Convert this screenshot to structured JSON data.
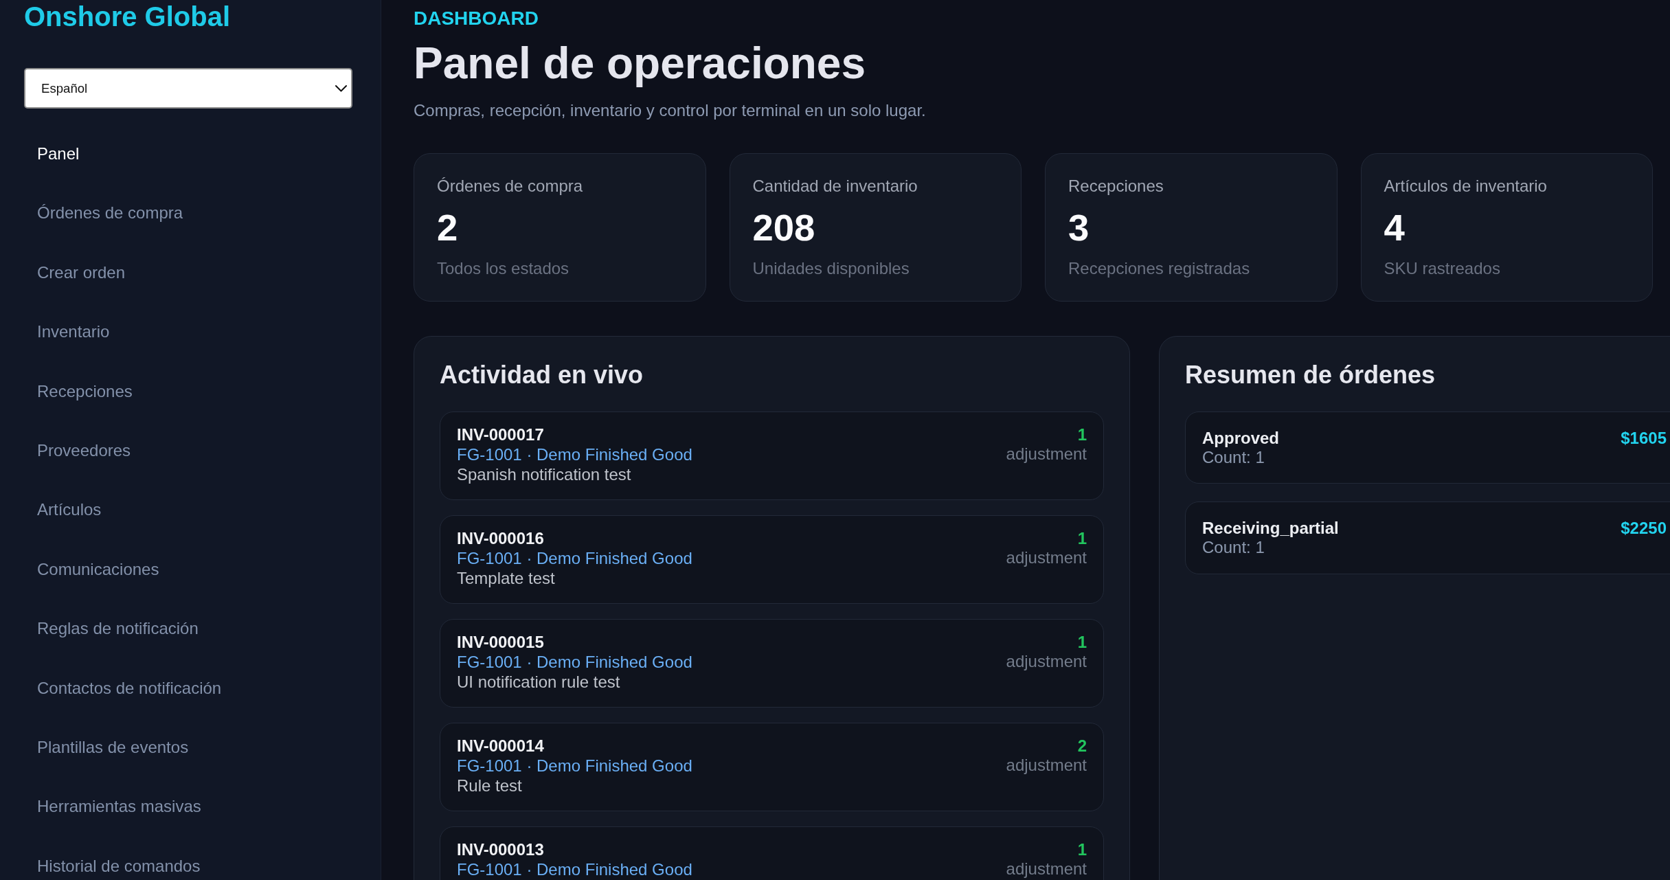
{
  "sidebar": {
    "brand": "Onshore Global",
    "language_select": {
      "value": "Español"
    },
    "items": [
      {
        "label": "Panel",
        "selected": true
      },
      {
        "label": "Órdenes de compra",
        "selected": false
      },
      {
        "label": "Crear orden",
        "selected": false
      },
      {
        "label": "Inventario",
        "selected": false
      },
      {
        "label": "Recepciones",
        "selected": false
      },
      {
        "label": "Proveedores",
        "selected": false
      },
      {
        "label": "Artículos",
        "selected": false
      },
      {
        "label": "Comunicaciones",
        "selected": false
      },
      {
        "label": "Reglas de notificación",
        "selected": false
      },
      {
        "label": "Contactos de notificación",
        "selected": false
      },
      {
        "label": "Plantillas de eventos",
        "selected": false
      },
      {
        "label": "Herramientas masivas",
        "selected": false
      },
      {
        "label": "Historial de comandos",
        "selected": false
      }
    ]
  },
  "header": {
    "eyebrow": "DASHBOARD",
    "title": "Panel de operaciones",
    "subtitle": "Compras, recepción, inventario y control por terminal en un solo lugar."
  },
  "stats": [
    {
      "label": "Órdenes de compra",
      "value": "2",
      "caption": "Todos los estados"
    },
    {
      "label": "Cantidad de inventario",
      "value": "208",
      "caption": "Unidades disponibles"
    },
    {
      "label": "Recepciones",
      "value": "3",
      "caption": "Recepciones registradas"
    },
    {
      "label": "Artículos de inventario",
      "value": "4",
      "caption": "SKU rastreados"
    }
  ],
  "activity": {
    "title": "Actividad en vivo",
    "items": [
      {
        "id": "INV-000017",
        "product": "FG-1001 · Demo Finished Good",
        "note": "Spanish notification test",
        "quantity": "1",
        "type": "adjustment"
      },
      {
        "id": "INV-000016",
        "product": "FG-1001 · Demo Finished Good",
        "note": "Template test",
        "quantity": "1",
        "type": "adjustment"
      },
      {
        "id": "INV-000015",
        "product": "FG-1001 · Demo Finished Good",
        "note": "UI notification rule test",
        "quantity": "1",
        "type": "adjustment"
      },
      {
        "id": "INV-000014",
        "product": "FG-1001 · Demo Finished Good",
        "note": "Rule test",
        "quantity": "2",
        "type": "adjustment"
      },
      {
        "id": "INV-000013",
        "product": "FG-1001 · Demo Finished Good",
        "quantity": "1",
        "type": "adjustment"
      }
    ]
  },
  "order_summary": {
    "title": "Resumen de órdenes",
    "items": [
      {
        "status": "Approved",
        "count": "Count: 1",
        "amount": "$1605"
      },
      {
        "status": "Receiving_partial",
        "count": "Count: 1",
        "amount": "$2250"
      }
    ]
  }
}
